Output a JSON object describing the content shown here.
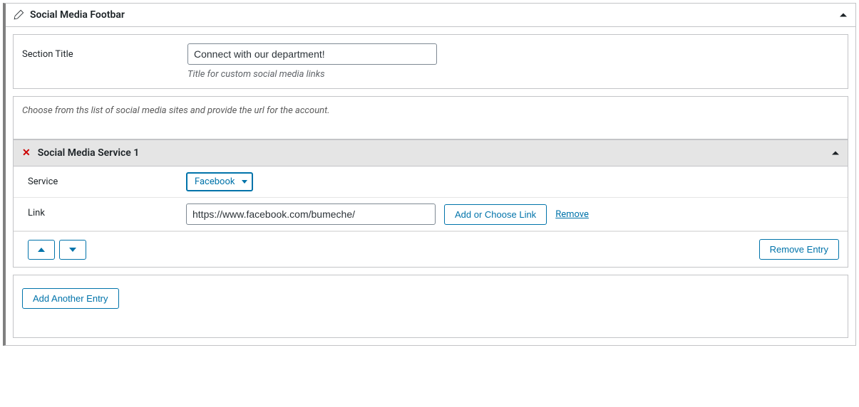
{
  "header": {
    "title": "Social Media Footbar"
  },
  "section_title": {
    "label": "Section Title",
    "value": "Connect with our department!",
    "help": "Title for custom social media links"
  },
  "description": "Choose from ths list of social media sites and provide the url for the account.",
  "service": {
    "title": "Social Media Service 1",
    "service_label": "Service",
    "service_value": "Facebook",
    "link_label": "Link",
    "link_value": "https://www.facebook.com/bumeche/",
    "add_choose_label": "Add or Choose Link",
    "remove_label": "Remove",
    "remove_entry_label": "Remove Entry"
  },
  "add_entry_label": "Add Another Entry"
}
